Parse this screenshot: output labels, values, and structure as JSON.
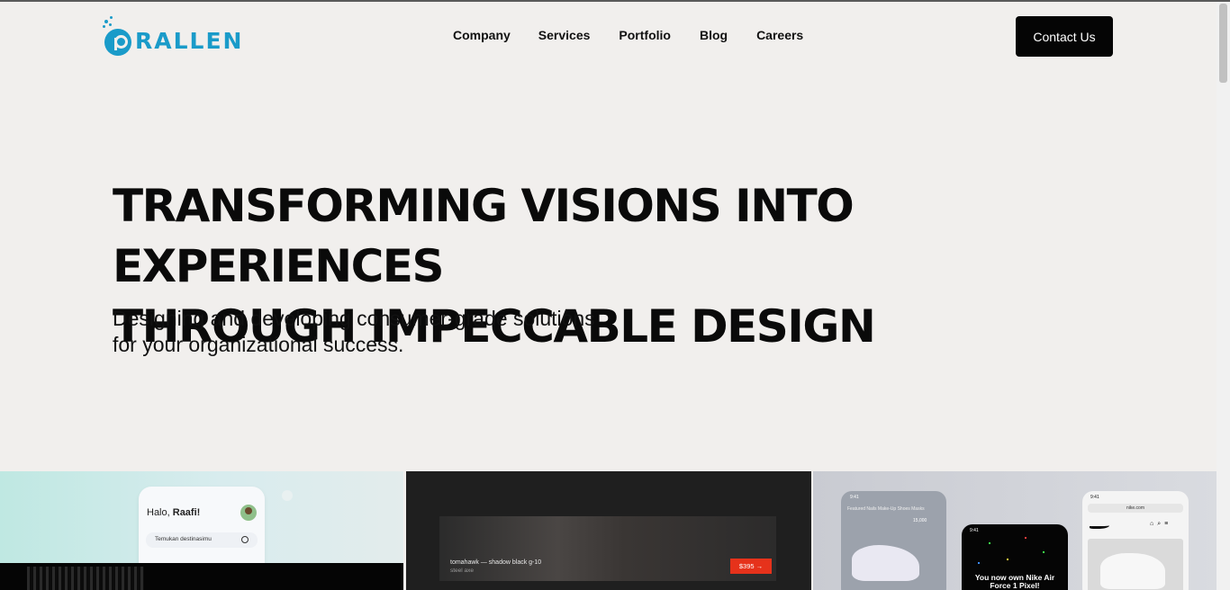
{
  "header": {
    "logo_text": "RALLEN",
    "nav": [
      "Company",
      "Services",
      "Portfolio",
      "Blog",
      "Careers"
    ],
    "cta_label": "Contact Us"
  },
  "hero": {
    "title_line1": "TRANSFORMING VISIONS INTO EXPERIENCES",
    "title_line2": "THROUGH IMPECCABLE DESIGN",
    "subtitle_line1": "Designing and developing consumer-grade solutions",
    "subtitle_line2": "for your organizational success."
  },
  "showcase": {
    "travel_app": {
      "greeting_prefix": "Halo, ",
      "greeting_name": "Raafi!",
      "search_placeholder": "Temukan destinasimu"
    },
    "product_page": {
      "product_title": "tomahawk — shadow black g-10",
      "product_sub": "steel axe",
      "price": "$395"
    },
    "nike_app": {
      "time": "9:41",
      "tabs": "Featured   Nails   Make-Up   Shoes   Masks",
      "coins": "15,000",
      "popup": "You now own Nike Air Force 1 Pixel!",
      "url": "nike.com"
    }
  },
  "colors": {
    "brand": "#1a9bc9",
    "background": "#f1efed",
    "cta": "#050505",
    "price_badge": "#e6321b"
  }
}
